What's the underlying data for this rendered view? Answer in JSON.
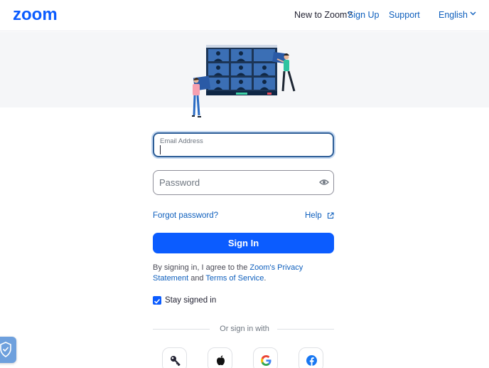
{
  "header": {
    "logo_text": "zoom",
    "new_to_zoom": "New to Zoom?",
    "sign_up": "Sign Up",
    "support": "Support",
    "language": "English"
  },
  "form": {
    "email_label": "Email Address",
    "email_value": "",
    "password_placeholder": "Password",
    "forgot_password": "Forgot password?",
    "help": "Help",
    "sign_in_button": "Sign In",
    "terms_prefix": "By signing in, I agree to the ",
    "privacy_link": "Zoom's Privacy Statement",
    "terms_and": " and ",
    "terms_link": "Terms of Service",
    "terms_suffix": ".",
    "stay_signed_in": "Stay signed in",
    "stay_signed_in_checked": true,
    "or_sign_in_with": "Or sign in with"
  },
  "social_providers": [
    {
      "name": "key-icon"
    },
    {
      "name": "apple-icon"
    },
    {
      "name": "google-icon"
    },
    {
      "name": "facebook-icon"
    }
  ],
  "colors": {
    "brand": "#0b5cff",
    "link": "#0e5fbd",
    "hero_bg": "#f5f6f8"
  }
}
